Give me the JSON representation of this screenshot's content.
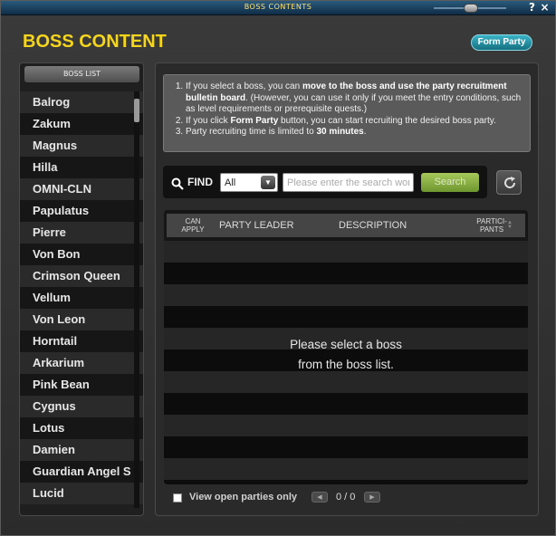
{
  "window": {
    "title": "BOSS CONTENTS",
    "help_label": "?",
    "close_label": "×"
  },
  "header": {
    "title": "BOSS CONTENT",
    "form_party_label": "Form Party"
  },
  "colors": {
    "accent_yellow": "#f6d51d",
    "form_party_teal": "#2aa0b4",
    "search_green": "#8ab445"
  },
  "sidebar": {
    "title": "BOSS LIST",
    "items": [
      {
        "label": "Balrog"
      },
      {
        "label": "Zakum"
      },
      {
        "label": "Magnus"
      },
      {
        "label": "Hilla"
      },
      {
        "label": "OMNI-CLN"
      },
      {
        "label": "Papulatus"
      },
      {
        "label": "Pierre"
      },
      {
        "label": "Von Bon"
      },
      {
        "label": "Crimson Queen"
      },
      {
        "label": "Vellum"
      },
      {
        "label": "Von Leon"
      },
      {
        "label": "Horntail"
      },
      {
        "label": "Arkarium"
      },
      {
        "label": "Pink Bean"
      },
      {
        "label": "Cygnus"
      },
      {
        "label": "Lotus"
      },
      {
        "label": "Damien"
      },
      {
        "label": "Guardian Angel S"
      },
      {
        "label": "Lucid"
      }
    ]
  },
  "info": {
    "line1_pre": "If you select a boss, you can ",
    "line1_bold": "move to the boss and use the party recruitment bulletin board",
    "line1_post": ". (However, you can use it only if you meet the entry conditions, such as level requirements or prerequisite quests.)",
    "line2_pre": "If you click ",
    "line2_bold": "Form Party",
    "line2_post": " button, you can start recruiting the desired boss party.",
    "line3_pre": "Party recruiting time is limited to ",
    "line3_bold": "30 minutes",
    "line3_post": "."
  },
  "find": {
    "label": "FIND",
    "filter_value": "All",
    "search_placeholder": "Please enter the search word.",
    "search_value": "",
    "search_button": "Search"
  },
  "table": {
    "columns": {
      "can_apply_1": "CAN",
      "can_apply_2": "APPLY",
      "party_leader": "PARTY LEADER",
      "description": "DESCRIPTION",
      "participants_1": "PARTICI-",
      "participants_2": "PANTS"
    },
    "rows": [],
    "empty_line1": "Please select a boss",
    "empty_line2": "from the boss list."
  },
  "footer": {
    "view_open_label": "View open parties only",
    "view_open_checked": false,
    "prev_label": "◀",
    "next_label": "▶",
    "page_text": "0 / 0"
  }
}
